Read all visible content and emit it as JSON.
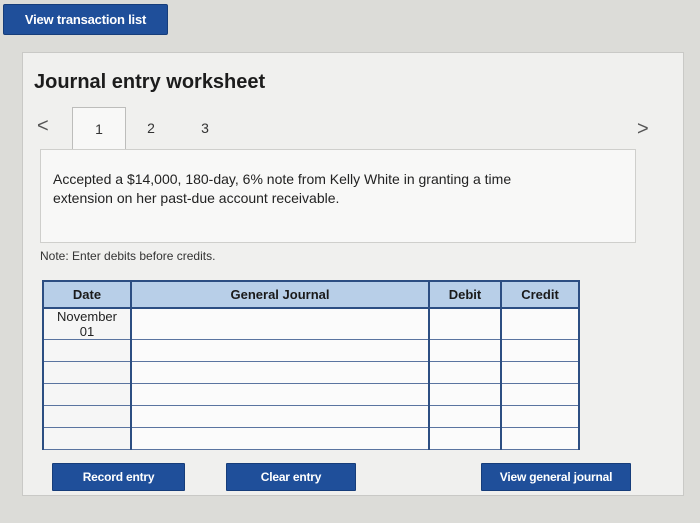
{
  "header": {
    "view_transaction_list": "View transaction list"
  },
  "worksheet": {
    "title": "Journal entry worksheet",
    "nav": {
      "prev": "<",
      "next": ">"
    },
    "tabs": [
      "1",
      "2",
      "3"
    ],
    "description": "Accepted a $14,000, 180-day, 6% note from Kelly White in granting a time extension on her past-due account receivable.",
    "note": "Note: Enter debits before credits."
  },
  "journal": {
    "headers": {
      "date": "Date",
      "general_journal": "General Journal",
      "debit": "Debit",
      "credit": "Credit"
    },
    "rows": [
      {
        "date_line1": "November",
        "date_line2": "01",
        "account": "",
        "debit": "",
        "credit": ""
      },
      {
        "date_line1": "",
        "date_line2": "",
        "account": "",
        "debit": "",
        "credit": ""
      },
      {
        "date_line1": "",
        "date_line2": "",
        "account": "",
        "debit": "",
        "credit": ""
      },
      {
        "date_line1": "",
        "date_line2": "",
        "account": "",
        "debit": "",
        "credit": ""
      },
      {
        "date_line1": "",
        "date_line2": "",
        "account": "",
        "debit": "",
        "credit": ""
      },
      {
        "date_line1": "",
        "date_line2": "",
        "account": "",
        "debit": "",
        "credit": ""
      }
    ]
  },
  "buttons": {
    "record_entry": "Record entry",
    "clear_entry": "Clear entry",
    "view_general_journal": "View general journal"
  }
}
